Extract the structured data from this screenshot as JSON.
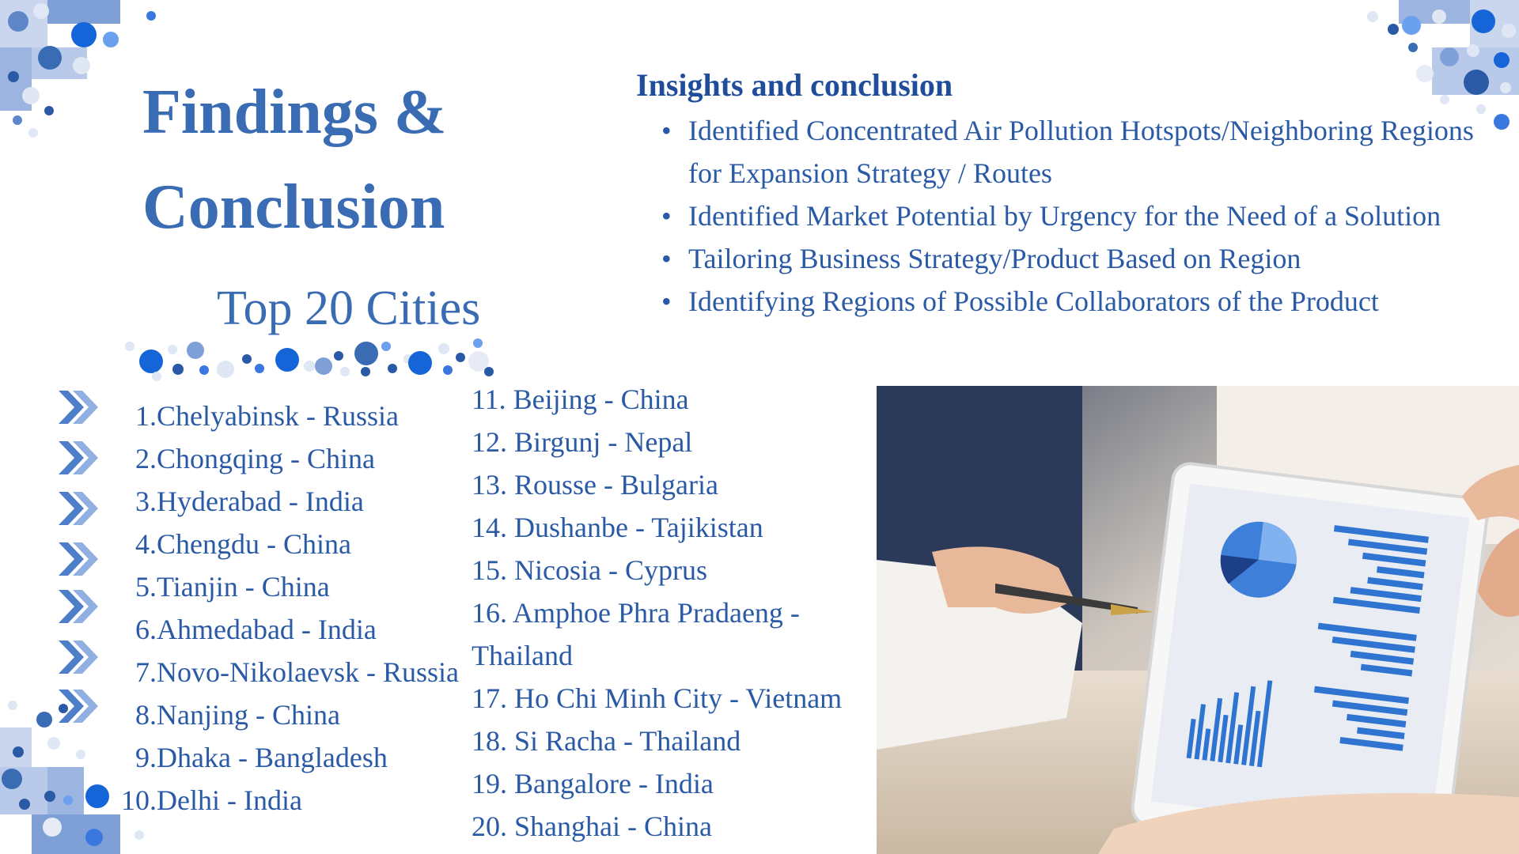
{
  "slide": {
    "title_line1": "Findings &",
    "title_line2": "Conclusion",
    "subtitle": "Top 20 Cities"
  },
  "insights": {
    "heading": "Insights and conclusion",
    "bullets": [
      "Identified Concentrated Air Pollution Hotspots/Neighboring Regions for Expansion Strategy / Routes",
      "Identified Market Potential by Urgency for the Need of a  Solution",
      "Tailoring Business Strategy/Product Based on Region",
      "Identifying Regions of Possible Collaborators of the Product"
    ]
  },
  "cities_left": [
    {
      "num": "1.",
      "name": "Chelyabinsk - Russia"
    },
    {
      "num": "2.",
      "name": "Chongqing - China"
    },
    {
      "num": "3.",
      "name": "Hyderabad - India"
    },
    {
      "num": "4.",
      "name": "Chengdu - China"
    },
    {
      "num": "5.",
      "name": "Tianjin - China"
    },
    {
      "num": "6.",
      "name": "Ahmedabad - India"
    },
    {
      "num": "7.",
      "name": "Novo-Nikolaevsk - Russia"
    },
    {
      "num": "8.",
      "name": "Nanjing - China"
    },
    {
      "num": "9.",
      "name": "Dhaka - Bangladesh"
    },
    {
      "num": "10.",
      "name": "Delhi - India"
    }
  ],
  "cities_right": [
    "11. Beijing - China",
    "12. Birgunj - Nepal",
    "13. Rousse - Bulgaria",
    "14. Dushanbe - Tajikistan",
    "15. Nicosia - Cyprus",
    "16. Amphoe Phra Pradaeng - Thailand",
    "17. Ho Chi Minh City - Vietnam",
    "18. Si Racha - Thailand",
    "19. Bangalore - India",
    "20. Shanghai - China"
  ],
  "icons": {
    "list_marker": "double-chevron-right-icon",
    "photo": "tablet-analytics-photo"
  },
  "colors": {
    "primary": "#3a6cb4",
    "dark": "#1f4d9a",
    "accent": "#1565d8"
  }
}
